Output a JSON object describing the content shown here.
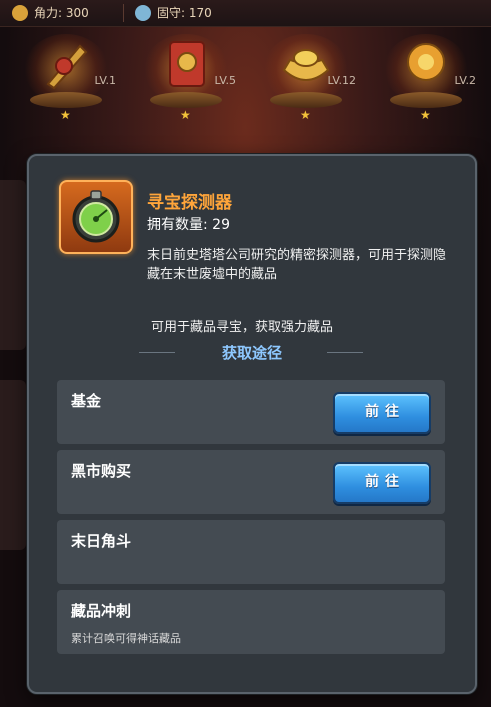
{
  "top_bar": {
    "stat1": "角力: 300",
    "stat2": "固守: 170"
  },
  "shelf": [
    {
      "level": "LV.1"
    },
    {
      "level": "LV.5"
    },
    {
      "level": "LV.12"
    },
    {
      "level": "LV.2"
    }
  ],
  "item": {
    "name": "寻宝探测器",
    "count_label": "拥有数量: 29",
    "description": "末日前史塔塔公司研究的精密探测器，可用于探测隐藏在末世废墟中的藏品",
    "usage": "可用于藏品寻宝，获取强力藏品"
  },
  "acquire": {
    "title": "获取途径",
    "sources": [
      {
        "label": "基金",
        "button": "前往",
        "sub": ""
      },
      {
        "label": "黑市购买",
        "button": "前往",
        "sub": ""
      },
      {
        "label": "末日角斗",
        "button": "",
        "sub": ""
      },
      {
        "label": "藏品冲刺",
        "button": "",
        "sub": "累计召唤可得神话藏品"
      }
    ]
  },
  "colors": {
    "name": "#ffa53a",
    "section_title": "#8ec8ff",
    "button": "#2f8fe0"
  }
}
